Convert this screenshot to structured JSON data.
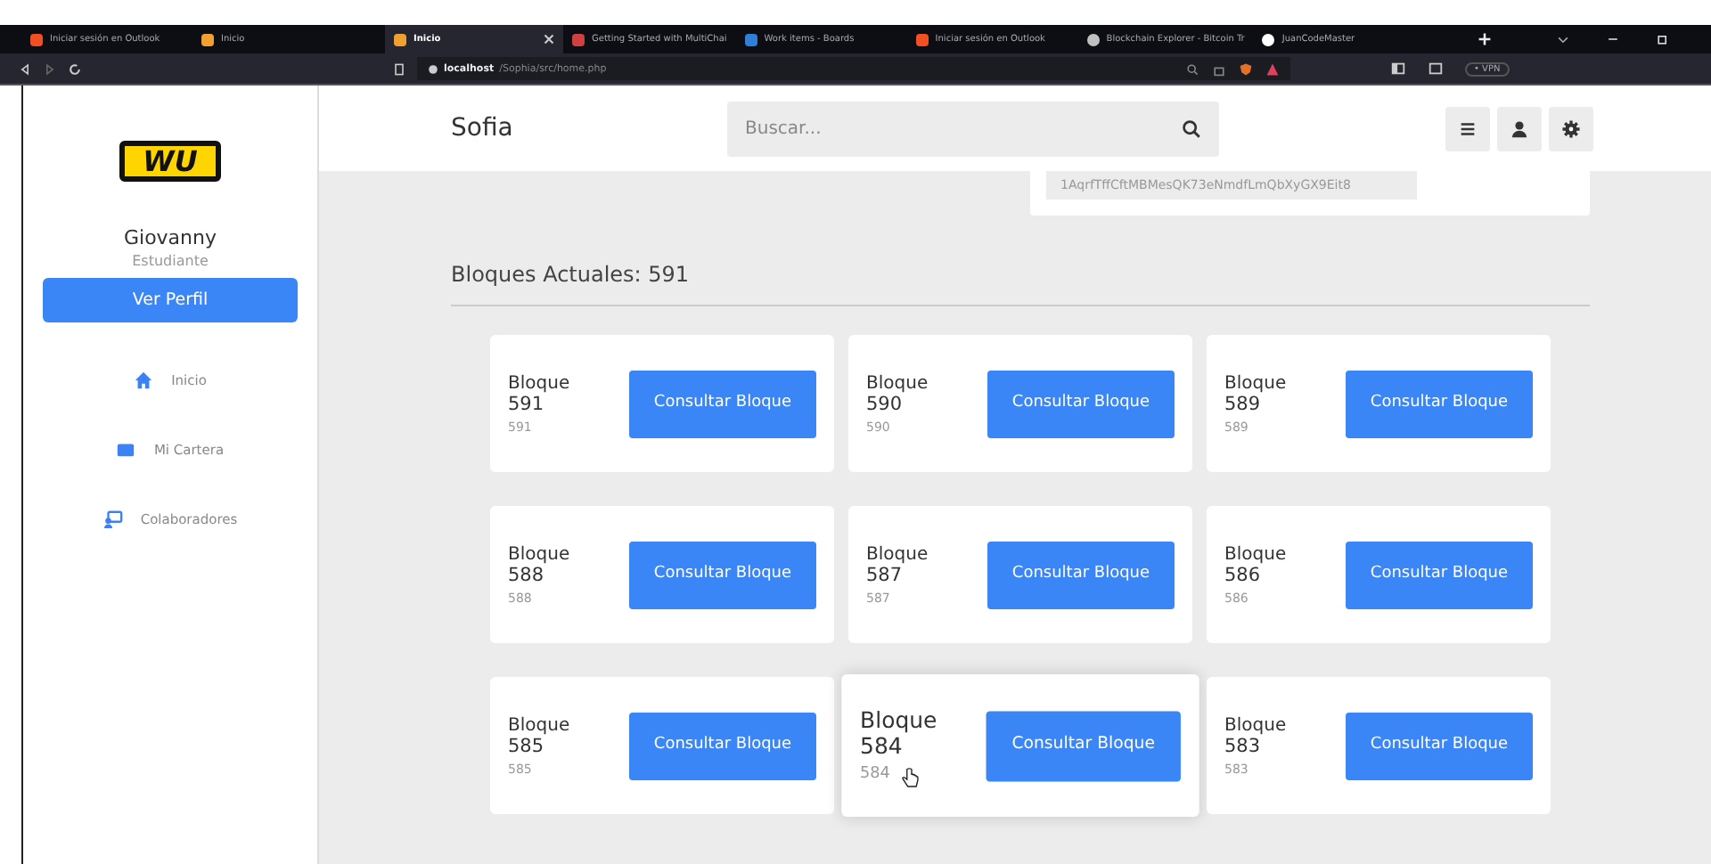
{
  "browser": {
    "tabs": [
      {
        "title": "Iniciar sesión en Outlook",
        "selected": false
      },
      {
        "title": "Inicio",
        "selected": false
      },
      {
        "title": "Inicio",
        "selected": true
      },
      {
        "title": "Getting Started with MultiChai",
        "selected": false
      },
      {
        "title": "Work items - Boards",
        "selected": false
      },
      {
        "title": "Iniciar sesión en Outlook",
        "selected": false
      },
      {
        "title": "Blockchain Explorer - Bitcoin Tr",
        "selected": false
      },
      {
        "title": "JuanCodeMaster",
        "selected": false
      }
    ],
    "url_host": "localhost",
    "url_path": "/Sophia/src/home.php",
    "vpn": "• VPN"
  },
  "sidebar": {
    "logo": "WU",
    "user": "Giovanny",
    "role": "Estudiante",
    "profile_button": "Ver Perfil",
    "items": [
      {
        "label": "Inicio"
      },
      {
        "label": "Mi Cartera"
      },
      {
        "label": "Colaboradores"
      }
    ]
  },
  "header": {
    "title": "Sofia",
    "search": {
      "placeholder": "Buscar..."
    }
  },
  "wallet_address": "1AqrfTffCftMBMesQK73eNmdfLmQbXyGX9Eit8",
  "section_title": "Bloques Actuales: 591",
  "blocks": [
    {
      "label": "Bloque",
      "number": "591",
      "sub": "591",
      "button": "Consultar Bloque",
      "hovered": false
    },
    {
      "label": "Bloque",
      "number": "590",
      "sub": "590",
      "button": "Consultar Bloque",
      "hovered": false
    },
    {
      "label": "Bloque",
      "number": "589",
      "sub": "589",
      "button": "Consultar Bloque",
      "hovered": false
    },
    {
      "label": "Bloque",
      "number": "588",
      "sub": "588",
      "button": "Consultar Bloque",
      "hovered": false
    },
    {
      "label": "Bloque",
      "number": "587",
      "sub": "587",
      "button": "Consultar Bloque",
      "hovered": false
    },
    {
      "label": "Bloque",
      "number": "586",
      "sub": "586",
      "button": "Consultar Bloque",
      "hovered": false
    },
    {
      "label": "Bloque",
      "number": "585",
      "sub": "585",
      "button": "Consultar Bloque",
      "hovered": false
    },
    {
      "label": "Bloque",
      "number": "584",
      "sub": "584",
      "button": "Consultar Bloque",
      "hovered": true
    },
    {
      "label": "Bloque",
      "number": "583",
      "sub": "583",
      "button": "Consultar Bloque",
      "hovered": false
    }
  ]
}
